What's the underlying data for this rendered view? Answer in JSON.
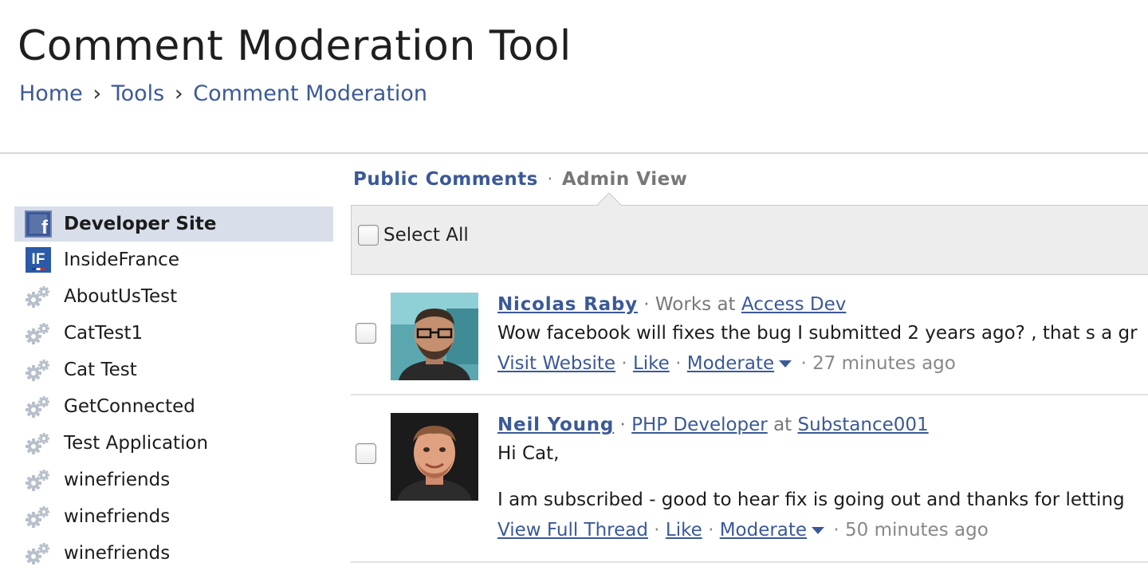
{
  "header": {
    "title": "Comment Moderation Tool",
    "breadcrumb": [
      {
        "label": "Home"
      },
      {
        "label": "Tools"
      },
      {
        "label": "Comment Moderation"
      }
    ],
    "separator": "›"
  },
  "sidebar": {
    "items": [
      {
        "label": "Developer Site",
        "icon": "facebook-icon",
        "selected": true
      },
      {
        "label": "InsideFrance",
        "icon": "insidefrance-icon",
        "icon_text": "IF"
      },
      {
        "label": "AboutUsTest",
        "icon": "gears-icon"
      },
      {
        "label": "CatTest1",
        "icon": "gears-icon"
      },
      {
        "label": "Cat Test",
        "icon": "gears-icon"
      },
      {
        "label": "GetConnected",
        "icon": "gears-icon"
      },
      {
        "label": "Test Application",
        "icon": "gears-icon"
      },
      {
        "label": "winefriends",
        "icon": "gears-icon"
      },
      {
        "label": "winefriends",
        "icon": "gears-icon"
      },
      {
        "label": "winefriends",
        "icon": "gears-icon"
      }
    ]
  },
  "tabs": {
    "active": "Public Comments",
    "separator": "·",
    "inactive": "Admin View"
  },
  "select_all": {
    "label": "Select All",
    "checked": false
  },
  "comments": [
    {
      "author": "Nicolas Raby",
      "sep1": " · ",
      "role_prefix": "Works at",
      "role": "",
      "at": "",
      "company": "Access Dev",
      "text": "Wow facebook will fixes the bug I submitted 2 years ago? , that s a gr",
      "actions": [
        "Visit Website",
        "Like",
        "Moderate"
      ],
      "time": "27 minutes ago",
      "checked": false
    },
    {
      "author": "Neil Young",
      "sep1": " · ",
      "role_prefix": "",
      "role": "PHP Developer",
      "at": "at",
      "company": "Substance001",
      "text_line1": "Hi Cat,",
      "text_line2": "I am subscribed - good to hear fix is going out and thanks for letting",
      "actions": [
        "View Full Thread",
        "Like",
        "Moderate"
      ],
      "time": "50 minutes ago",
      "checked": false
    }
  ],
  "colors": {
    "link": "#3b5998",
    "selected_bg": "#d8dfea",
    "bar_bg": "#ededed"
  }
}
